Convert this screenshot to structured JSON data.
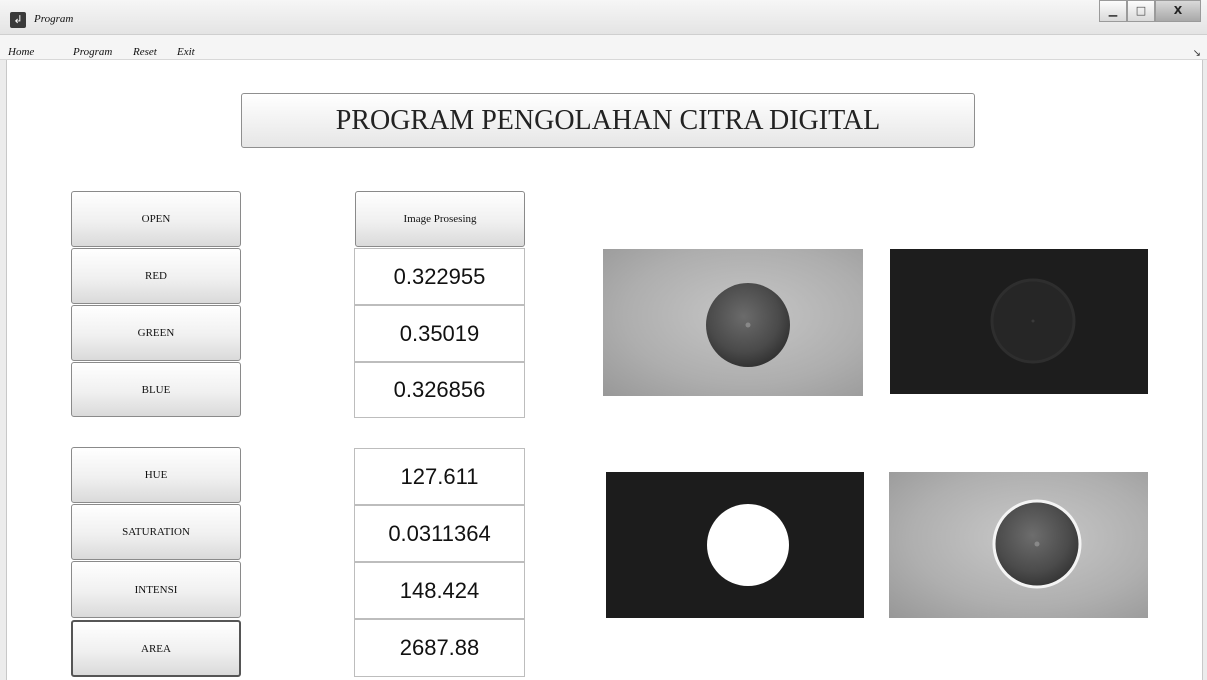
{
  "window": {
    "title": "Program",
    "icon": "matlab-figure-icon"
  },
  "window_controls": {
    "minimize": "▁",
    "maximize": "□",
    "close": "X"
  },
  "menu": {
    "items": [
      "Home",
      "Program",
      "Reset",
      "Exit"
    ],
    "overflow_icon": "↘"
  },
  "header": {
    "title": "PROGRAM PENGOLAHAN CITRA DIGITAL"
  },
  "buttons": {
    "open": "OPEN",
    "red": "RED",
    "green": "GREEN",
    "blue": "BLUE",
    "hue": "HUE",
    "saturation": "SATURATION",
    "intensi": "INTENSI",
    "area": "AREA",
    "image_processing": "Image Prosesing"
  },
  "values": {
    "red": "0.322955",
    "green": "0.35019",
    "blue": "0.326856",
    "hue": "127.611",
    "saturation": "0.0311364",
    "intensi": "148.424",
    "area": "2687.88"
  },
  "images": {
    "original": "original-grayscale-image",
    "filtered": "dark-filtered-image",
    "binary": "binary-mask-image",
    "segmented": "segmented-outline-image"
  }
}
